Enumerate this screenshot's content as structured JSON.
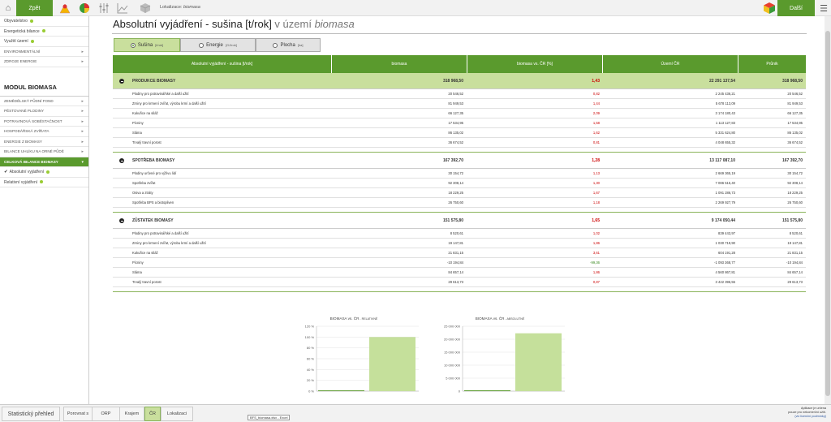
{
  "topbar": {
    "back_label": "Zpět",
    "next_label": "Další",
    "location_prefix": "Lokalizace: ",
    "location_value": "biomasa"
  },
  "sidebar": {
    "top_items": [
      {
        "label": "Obyvatelstvo"
      },
      {
        "label": "Energetická bilance"
      },
      {
        "label": "Využití území"
      }
    ],
    "sections_top": [
      {
        "label": "ENVIRONMENTÁLNÍ"
      },
      {
        "label": "ZDROJE ENERGIE"
      }
    ],
    "heading": "MODUL BIOMASA",
    "modules": [
      {
        "label": "ZEMĚDĚLSKÝ PŮDNÍ FOND"
      },
      {
        "label": "PĚSTOVANÉ PLODINY"
      },
      {
        "label": "POTRAVINOVÁ SOBĚSTAČNOST"
      },
      {
        "label": "HOSPODÁŘSKÁ ZVÍŘATA"
      },
      {
        "label": "ENERGIE Z BIOMASY"
      },
      {
        "label": "BILANCE UHLÍKU NA ORNÉ PŮDĚ"
      },
      {
        "label": "CELKOVÁ BILANCE BIOMASY"
      }
    ],
    "subitems": [
      {
        "label": "Absolutní vyjádření"
      },
      {
        "label": "Relativní vyjádření"
      }
    ]
  },
  "main": {
    "title_main": "Absolutní vyjádření - sušina [t/rok]",
    "title_mid": " v území ",
    "title_place": "biomasa",
    "tabs": [
      {
        "label": "Sušina",
        "unit": "[t/rok]"
      },
      {
        "label": "Energie",
        "unit": "[GJ/rok]"
      },
      {
        "label": "Plocha",
        "unit": "[ha]"
      }
    ]
  },
  "table": {
    "headers": [
      "Absolutní vyjádření - sušina [t/rok]",
      "biomasa",
      "biomasa vs. ČR [%]",
      "Území ČR",
      "Průnik"
    ],
    "groups": [
      {
        "title": "PRODUKCE BIOMASY",
        "values": [
          "318 968,50",
          "1,43",
          "22 291 137,54",
          "318 968,50"
        ],
        "rows": [
          {
            "label": "Plodiny pro potravinářské a další užití",
            "values": [
              "20 546,52",
              "0,82",
              "2 245 436,21",
              "20 546,52"
            ]
          },
          {
            "label": "Zrniny pro krmení zvířat, výrobu krmí a další užití",
            "values": [
              "81 949,53",
              "1,44",
              "5 678 113,09",
              "81 949,53"
            ]
          },
          {
            "label": "Kukuřice na siláž",
            "values": [
              "66 127,35",
              "2,09",
              "3 174 180,43",
              "66 127,35"
            ]
          },
          {
            "label": "Pícniny",
            "values": [
              "17 534,95",
              "1,58",
              "1 113 127,83",
              "17 534,95"
            ]
          },
          {
            "label": "Sláma",
            "values": [
              "86 135,02",
              "1,62",
              "5 331 624,80",
              "86 135,02"
            ]
          },
          {
            "label": "Trvalý travní porost",
            "values": [
              "36 674,52",
              "0,81",
              "4 048 655,32",
              "36 674,52"
            ]
          }
        ]
      },
      {
        "title": "SPOTŘEBA BIOMASY",
        "values": [
          "167 392,70",
          "1,28",
          "13 117 087,10",
          "167 392,70"
        ],
        "rows": [
          {
            "label": "Plodiny určené pro výživu lidí",
            "values": [
              "30 154,72",
              "1,13",
              "2 669 365,19",
              "30 154,72"
            ]
          },
          {
            "label": "Spotřeba zvířat",
            "values": [
              "92 308,14",
              "1,30",
              "7 086 515,40",
              "92 308,14"
            ]
          },
          {
            "label": "Osiva a ztráty",
            "values": [
              "18 229,25",
              "1,67",
              "1 091 286,73",
              "18 229,25"
            ]
          },
          {
            "label": "Spotřeba BPS a biotopliven",
            "values": [
              "26 750,60",
              "1,18",
              "2 269 927,79",
              "26 750,60"
            ]
          }
        ]
      },
      {
        "title": "ZŮSTATEK BIOMASY",
        "values": [
          "151 575,80",
          "1,65",
          "9 174 050,44",
          "151 575,80"
        ],
        "rows": [
          {
            "label": "Plodiny pro potravinářské a další užití",
            "values": [
              "8 520,61",
              "1,02",
              "839 443,97",
              "8 520,61"
            ]
          },
          {
            "label": "Zrniny pro krmení zvířat, výrobu krmí a další užití",
            "values": [
              "19 147,81",
              "1,86",
              "1 030 719,90",
              "19 147,81"
            ]
          },
          {
            "label": "Kukuřice na siláž",
            "values": [
              "21 831,15",
              "3,61",
              "604 191,28",
              "21 831,15"
            ]
          },
          {
            "label": "Pícniny",
            "values": [
              "-10 194,84",
              "-99,36",
              "-1 093 368,77",
              "-10 194,84"
            ],
            "green": true
          },
          {
            "label": "Sláma",
            "values": [
              "84 657,14",
              "1,86",
              "4 560 867,81",
              "84 657,14"
            ]
          },
          {
            "label": "Trvalý travní porost",
            "values": [
              "29 613,73",
              "0,87",
              "3 422 396,55",
              "29 613,73"
            ]
          }
        ]
      }
    ]
  },
  "chart_data": [
    {
      "type": "bar",
      "title": "BIOMASA   vs.   ČR",
      "subtitle": "- RELATIVNĚ",
      "categories": [
        "biomasa",
        "ČR"
      ],
      "values": [
        1.43,
        100
      ],
      "yticks": [
        "0 %",
        "20 %",
        "40 %",
        "60 %",
        "80 %",
        "100 %",
        "120 %"
      ],
      "ylim": [
        0,
        120
      ],
      "colors": [
        "#5a9a2d",
        "#c5e09b"
      ]
    },
    {
      "type": "bar",
      "title": "BIOMASA   vs.   ČR",
      "subtitle": "- ABSOLUTNĚ",
      "categories": [
        "biomasa",
        "ČR"
      ],
      "values": [
        318968.5,
        22291137.54
      ],
      "yticks": [
        "0",
        "5 000 000",
        "10 000 000",
        "15 000 000",
        "20 000 000",
        "25 000 000"
      ],
      "ylim": [
        0,
        25000000
      ],
      "colors": [
        "#5a9a2d",
        "#c5e09b"
      ]
    }
  ],
  "bottombar": {
    "stat_label": "Statistický přehled",
    "compare_label": "Porovnat s",
    "orp_label": "ORP",
    "kraj_label": "Krajem",
    "cr_label": "ČR",
    "lok_label": "Lokalizaci",
    "file_label": "BFS_biomasa.xlsx - Excel",
    "note_line1": "Aplikace je určena",
    "note_line2": "pouze pro nekomerční užití.",
    "note_link": "(viz licenční podmínky)"
  }
}
